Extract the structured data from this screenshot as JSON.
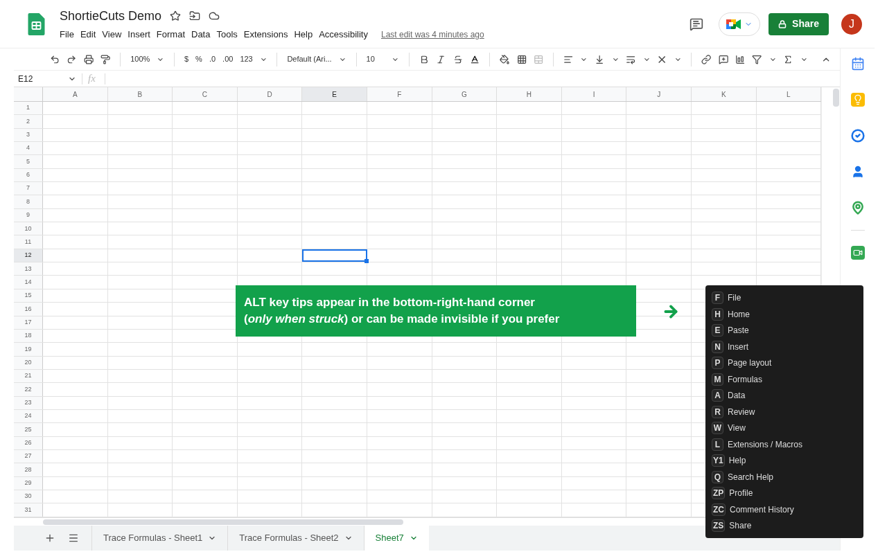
{
  "document": {
    "title": "ShortieCuts Demo",
    "last_edit": "Last edit was 4 minutes ago",
    "avatar": "J",
    "share": "Share"
  },
  "menu": [
    "File",
    "Edit",
    "View",
    "Insert",
    "Format",
    "Data",
    "Tools",
    "Extensions",
    "Help",
    "Accessibility"
  ],
  "toolbar": {
    "zoom": "100%",
    "currency": "$",
    "percent": "%",
    "decrease_decimals": ".0",
    "increase_decimals": ".00",
    "number_format": "123",
    "font": "Default (Ari...",
    "font_size": "10"
  },
  "formula_bar": {
    "name_box": "E12",
    "fx": "fx"
  },
  "columns": [
    {
      "label": "A",
      "selected": false
    },
    {
      "label": "B",
      "selected": false
    },
    {
      "label": "C",
      "selected": false
    },
    {
      "label": "D",
      "selected": false
    },
    {
      "label": "E",
      "selected": true
    },
    {
      "label": "F",
      "selected": false
    },
    {
      "label": "G",
      "selected": false
    },
    {
      "label": "H",
      "selected": false
    },
    {
      "label": "I",
      "selected": false
    },
    {
      "label": "J",
      "selected": false
    },
    {
      "label": "K",
      "selected": false
    },
    {
      "label": "L",
      "selected": false
    }
  ],
  "rows": [
    {
      "label": "1",
      "selected": false
    },
    {
      "label": "2",
      "selected": false
    },
    {
      "label": "3",
      "selected": false
    },
    {
      "label": "4",
      "selected": false
    },
    {
      "label": "5",
      "selected": false
    },
    {
      "label": "6",
      "selected": false
    },
    {
      "label": "7",
      "selected": false
    },
    {
      "label": "8",
      "selected": false
    },
    {
      "label": "9",
      "selected": false
    },
    {
      "label": "10",
      "selected": false
    },
    {
      "label": "11",
      "selected": false
    },
    {
      "label": "12",
      "selected": true
    },
    {
      "label": "13",
      "selected": false
    },
    {
      "label": "14",
      "selected": false
    },
    {
      "label": "15",
      "selected": false
    },
    {
      "label": "16",
      "selected": false
    },
    {
      "label": "17",
      "selected": false
    },
    {
      "label": "18",
      "selected": false
    },
    {
      "label": "19",
      "selected": false
    },
    {
      "label": "20",
      "selected": false
    },
    {
      "label": "21",
      "selected": false
    },
    {
      "label": "22",
      "selected": false
    },
    {
      "label": "23",
      "selected": false
    },
    {
      "label": "24",
      "selected": false
    },
    {
      "label": "25",
      "selected": false
    },
    {
      "label": "26",
      "selected": false
    },
    {
      "label": "27",
      "selected": false
    },
    {
      "label": "28",
      "selected": false
    },
    {
      "label": "29",
      "selected": false
    },
    {
      "label": "30",
      "selected": false
    },
    {
      "label": "31",
      "selected": false
    }
  ],
  "sheet_tabs": [
    {
      "label": "Trace Formulas - Sheet1",
      "selected": false
    },
    {
      "label": "Trace Formulas - Sheet2",
      "selected": false
    },
    {
      "label": "Sheet7",
      "selected": true
    }
  ],
  "callout": {
    "lines": [
      "ALT key tips appear in the bottom-right-hand corner",
      "(*only when struck*) or can be made invisible if you prefer"
    ]
  },
  "key_tips": [
    {
      "key": "F",
      "label": "File"
    },
    {
      "key": "H",
      "label": "Home"
    },
    {
      "key": "E",
      "label": "Paste"
    },
    {
      "key": "N",
      "label": "Insert"
    },
    {
      "key": "P",
      "label": "Page layout"
    },
    {
      "key": "M",
      "label": "Formulas"
    },
    {
      "key": "A",
      "label": "Data"
    },
    {
      "key": "R",
      "label": "Review"
    },
    {
      "key": "W",
      "label": "View"
    },
    {
      "key": "L",
      "label": "Extensions / Macros"
    },
    {
      "key": "Y1",
      "label": "Help"
    },
    {
      "key": "Q",
      "label": "Search Help"
    },
    {
      "key": "ZP",
      "label": "Profile"
    },
    {
      "key": "ZC",
      "label": "Comment History"
    },
    {
      "key": "ZS",
      "label": "Share"
    }
  ]
}
